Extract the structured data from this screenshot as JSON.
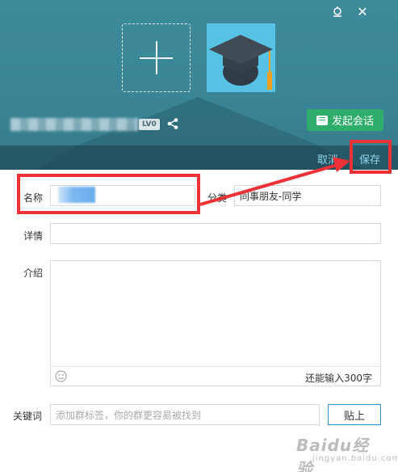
{
  "header": {
    "level_badge": "LV0",
    "start_chat_label": "发起会话",
    "cancel_label": "取消",
    "save_label": "保存",
    "avatar_color": "#58c2e5",
    "accent_green": "#2eae6a"
  },
  "form": {
    "name_label": "名称",
    "name_value": "",
    "category_label": "分类",
    "category_value": "同事朋友-同学",
    "detail_label": "详情",
    "detail_value": "",
    "intro_label": "介绍",
    "intro_value": "",
    "intro_remaining": "还能输入300字",
    "keyword_label": "关键词",
    "keyword_placeholder": "添加群标签，你的群更容易被找到",
    "paste_label": "贴上"
  },
  "icons": {
    "pin": "pin-icon",
    "close": "close-icon",
    "add": "plus-icon",
    "avatar": "graduation-cap-icon",
    "chat": "chat-bubble-icon",
    "share": "share-icon",
    "emoji": "smiley-icon"
  },
  "annotations": {
    "highlight_color": "#ec3237"
  },
  "watermark": {
    "text": "Baidu经验",
    "sub": "jingyan.baidu.com"
  }
}
